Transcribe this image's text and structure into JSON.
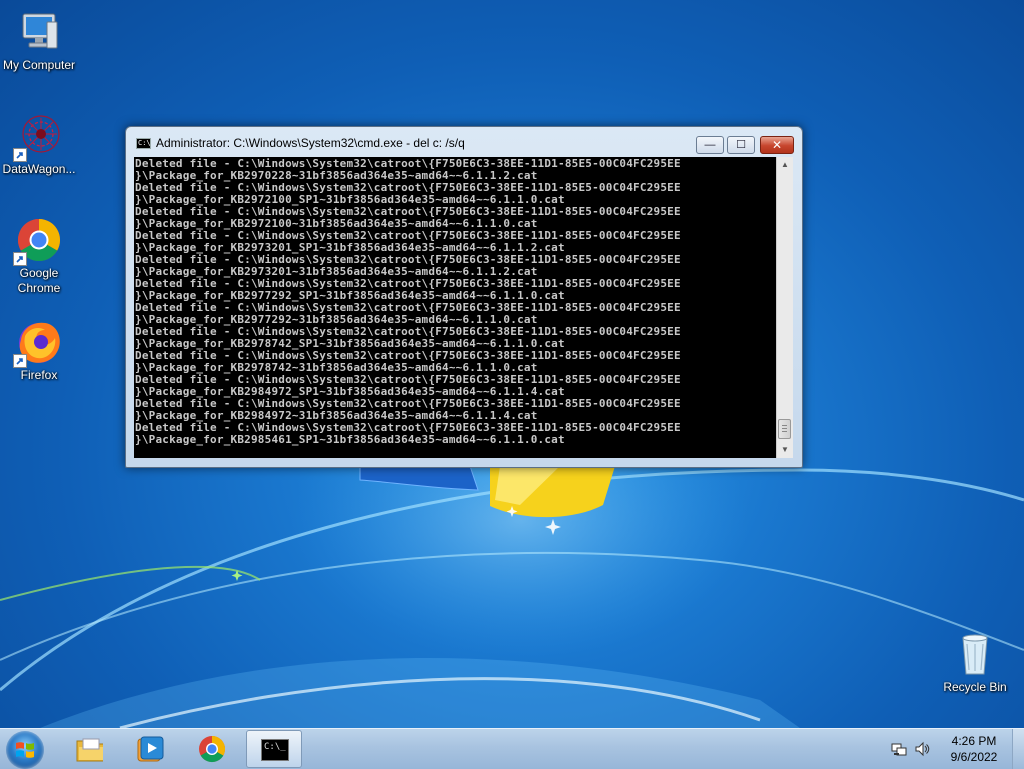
{
  "desktop": {
    "icons": [
      {
        "label": "My Computer",
        "icon": "computer-icon"
      },
      {
        "label": "DataWagon...",
        "icon": "datawagon-icon"
      },
      {
        "label": "Google\nChrome",
        "icon": "chrome-icon"
      },
      {
        "label": "Firefox",
        "icon": "firefox-icon"
      },
      {
        "label": "Recycle Bin",
        "icon": "recycle-bin-icon"
      }
    ]
  },
  "window": {
    "title": "Administrator: C:\\Windows\\System32\\cmd.exe - del  c: /s/q",
    "icon_text": "C:\\",
    "buttons": {
      "minimize": "—",
      "maximize": "☐",
      "close": "✕"
    },
    "console_lines": [
      "Deleted file - C:\\Windows\\System32\\catroot\\{F750E6C3-38EE-11D1-85E5-00C04FC295EE",
      "}\\Package_for_KB2970228~31bf3856ad364e35~amd64~~6.1.1.2.cat",
      "Deleted file - C:\\Windows\\System32\\catroot\\{F750E6C3-38EE-11D1-85E5-00C04FC295EE",
      "}\\Package_for_KB2972100_SP1~31bf3856ad364e35~amd64~~6.1.1.0.cat",
      "Deleted file - C:\\Windows\\System32\\catroot\\{F750E6C3-38EE-11D1-85E5-00C04FC295EE",
      "}\\Package_for_KB2972100~31bf3856ad364e35~amd64~~6.1.1.0.cat",
      "Deleted file - C:\\Windows\\System32\\catroot\\{F750E6C3-38EE-11D1-85E5-00C04FC295EE",
      "}\\Package_for_KB2973201_SP1~31bf3856ad364e35~amd64~~6.1.1.2.cat",
      "Deleted file - C:\\Windows\\System32\\catroot\\{F750E6C3-38EE-11D1-85E5-00C04FC295EE",
      "}\\Package_for_KB2973201~31bf3856ad364e35~amd64~~6.1.1.2.cat",
      "Deleted file - C:\\Windows\\System32\\catroot\\{F750E6C3-38EE-11D1-85E5-00C04FC295EE",
      "}\\Package_for_KB2977292_SP1~31bf3856ad364e35~amd64~~6.1.1.0.cat",
      "Deleted file - C:\\Windows\\System32\\catroot\\{F750E6C3-38EE-11D1-85E5-00C04FC295EE",
      "}\\Package_for_KB2977292~31bf3856ad364e35~amd64~~6.1.1.0.cat",
      "Deleted file - C:\\Windows\\System32\\catroot\\{F750E6C3-38EE-11D1-85E5-00C04FC295EE",
      "}\\Package_for_KB2978742_SP1~31bf3856ad364e35~amd64~~6.1.1.0.cat",
      "Deleted file - C:\\Windows\\System32\\catroot\\{F750E6C3-38EE-11D1-85E5-00C04FC295EE",
      "}\\Package_for_KB2978742~31bf3856ad364e35~amd64~~6.1.1.0.cat",
      "Deleted file - C:\\Windows\\System32\\catroot\\{F750E6C3-38EE-11D1-85E5-00C04FC295EE",
      "}\\Package_for_KB2984972_SP1~31bf3856ad364e35~amd64~~6.1.1.4.cat",
      "Deleted file - C:\\Windows\\System32\\catroot\\{F750E6C3-38EE-11D1-85E5-00C04FC295EE",
      "}\\Package_for_KB2984972~31bf3856ad364e35~amd64~~6.1.1.4.cat",
      "Deleted file - C:\\Windows\\System32\\catroot\\{F750E6C3-38EE-11D1-85E5-00C04FC295EE",
      "}\\Package_for_KB2985461_SP1~31bf3856ad364e35~amd64~~6.1.1.0.cat"
    ]
  },
  "taskbar": {
    "items": [
      "explorer-icon",
      "media-player-icon",
      "chrome-icon",
      "cmd-icon"
    ],
    "active_item": "cmd-icon",
    "cmd_icon_text": "C:\\_",
    "tray": [
      "network-icon",
      "speaker-icon"
    ],
    "time": "4:26 PM",
    "date": "9/6/2022"
  },
  "colors": {
    "desktop_blue": "#1a78cf",
    "console_bg": "#000000",
    "console_text": "#c8c8c8",
    "close_button": "#c7452d"
  }
}
